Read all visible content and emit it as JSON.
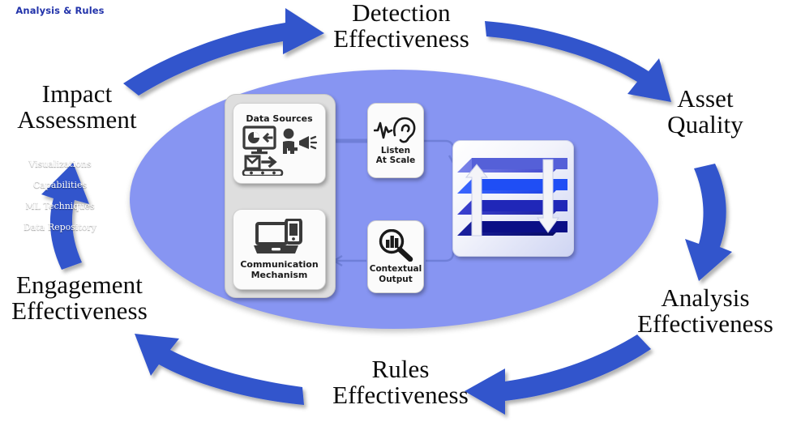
{
  "colors": {
    "arrow_blue": "#3355cc",
    "ellipse_fill": "#8795f2",
    "panel_title": "#2233aa",
    "layer_visualizations": "#5560d8",
    "layer_capabilities": "#1f4ef5",
    "layer_ml_techniques": "#2027b8",
    "layer_data_repository": "#0b0f86",
    "card_bg": "#fbfbfb",
    "grey_container": "#dedede",
    "connector_line": "#6f7fd8"
  },
  "cycle": {
    "labels": [
      {
        "id": "detection",
        "text": "Detection\nEffectiveness"
      },
      {
        "id": "asset",
        "text": "Asset\nQuality"
      },
      {
        "id": "analysis",
        "text": "Analysis\nEffectiveness"
      },
      {
        "id": "rules",
        "text": "Rules\nEffectiveness"
      },
      {
        "id": "engagement",
        "text": "Engagement\nEffectiveness"
      },
      {
        "id": "impact",
        "text": "Impact\nAssessment"
      }
    ],
    "arrows": [
      {
        "id": "impact-to-detection",
        "from": "Impact Assessment",
        "to": "Detection Effectiveness"
      },
      {
        "id": "detection-to-asset",
        "from": "Detection Effectiveness",
        "to": "Asset Quality"
      },
      {
        "id": "asset-to-analysis",
        "from": "Asset Quality",
        "to": "Analysis Effectiveness"
      },
      {
        "id": "analysis-to-rules",
        "from": "Analysis Effectiveness",
        "to": "Rules Effectiveness"
      },
      {
        "id": "rules-to-engagement",
        "from": "Rules Effectiveness",
        "to": "Engagement Effectiveness"
      },
      {
        "id": "engagement-to-impact",
        "from": "Engagement Effectiveness",
        "to": "Impact Assessment"
      }
    ]
  },
  "core": {
    "cards": {
      "data_sources": {
        "label": "Data Sources",
        "icon": "monitor-chart-megaphone-conveyor-icon"
      },
      "communication": {
        "label": "Communication\nMechanism",
        "icon": "laptop-phone-icon"
      },
      "listen": {
        "label": "Listen\nAt Scale",
        "icon": "ear-waveform-icon"
      },
      "contextual": {
        "label": "Contextual\nOutput",
        "icon": "magnifier-barchart-icon"
      }
    },
    "panel": {
      "title": "Analysis & Rules",
      "layers": [
        {
          "name": "Visualizations",
          "color": "#5560d8"
        },
        {
          "name": "Capabilities",
          "color": "#1f4ef5"
        },
        {
          "name": "ML Techniques",
          "color": "#2027b8"
        },
        {
          "name": "Data Repository",
          "color": "#0b0f86"
        }
      ],
      "side_arrows": [
        {
          "id": "stack-up-arrow",
          "direction": "up"
        },
        {
          "id": "stack-down-arrow",
          "direction": "down"
        }
      ]
    },
    "connectors": [
      {
        "id": "data-to-listen",
        "from": "Data Sources",
        "to": "Listen At Scale"
      },
      {
        "id": "listen-to-panel",
        "from": "Listen At Scale",
        "to": "Analysis & Rules"
      },
      {
        "id": "panel-to-ctx",
        "from": "Analysis & Rules",
        "to": "Contextual Output"
      },
      {
        "id": "ctx-to-comm",
        "from": "Contextual Output",
        "to": "Communication Mechanism"
      },
      {
        "id": "comm-to-data",
        "from": "Communication Mechanism",
        "to": "Data Sources"
      }
    ]
  }
}
